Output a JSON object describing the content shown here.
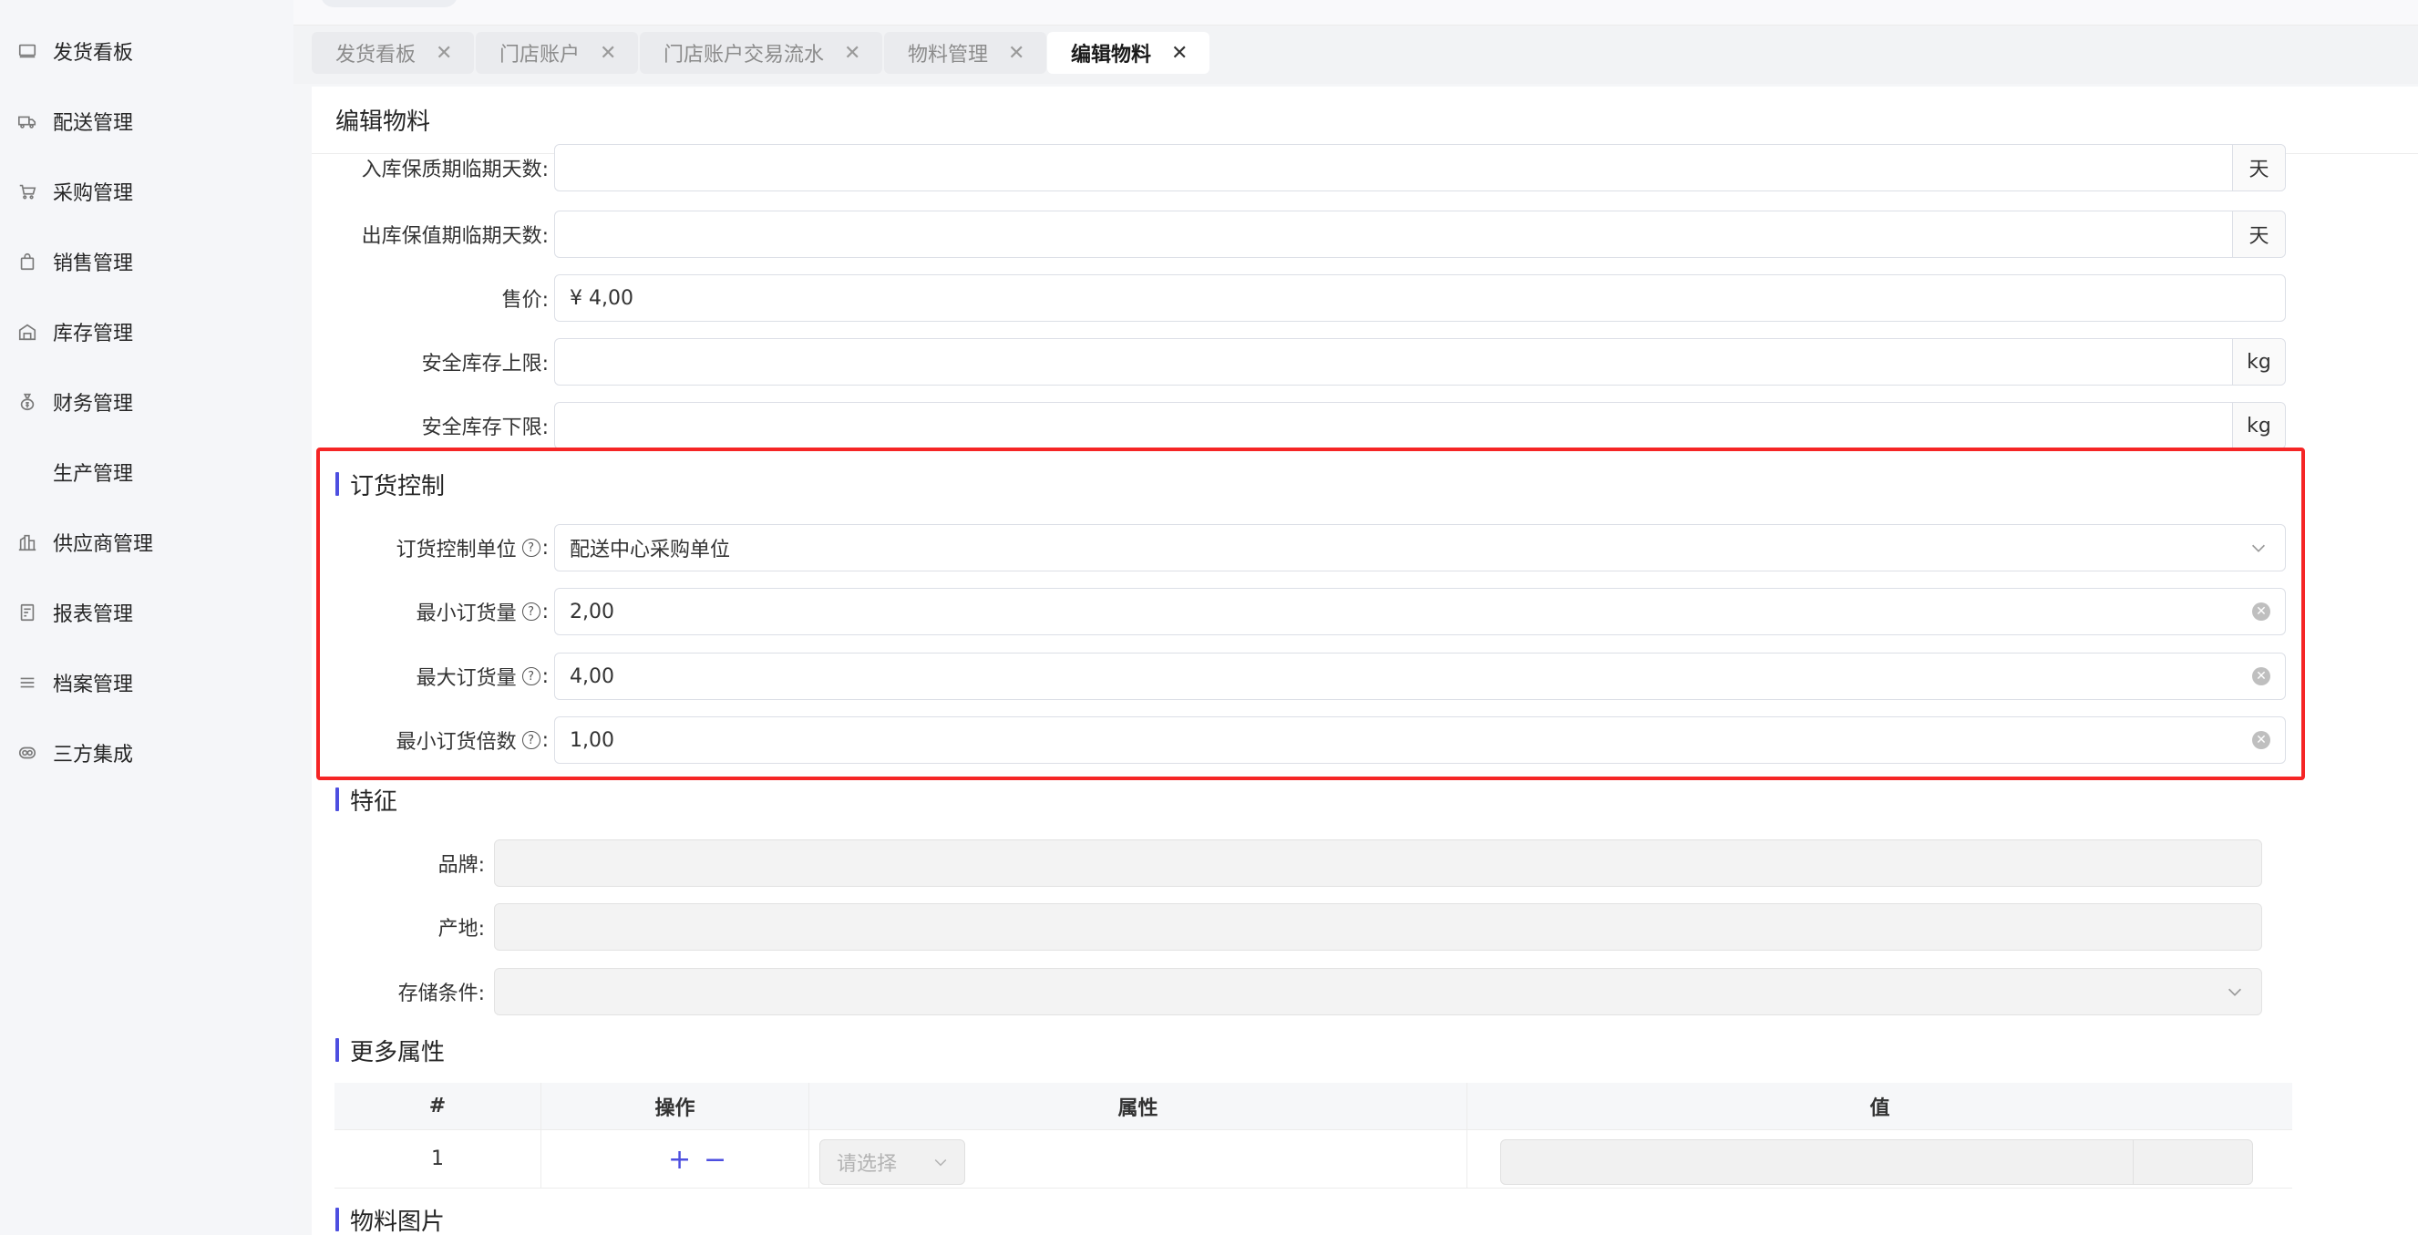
{
  "sidebar": {
    "items": [
      {
        "label": "发货看板",
        "icon": "monitor-icon"
      },
      {
        "label": "配送管理",
        "icon": "truck-icon"
      },
      {
        "label": "采购管理",
        "icon": "cart-icon"
      },
      {
        "label": "销售管理",
        "icon": "bag-icon"
      },
      {
        "label": "库存管理",
        "icon": "warehouse-icon"
      },
      {
        "label": "财务管理",
        "icon": "money-bag-icon"
      },
      {
        "label": "生产管理",
        "icon": ""
      },
      {
        "label": "供应商管理",
        "icon": "building-icon"
      },
      {
        "label": "报表管理",
        "icon": "report-icon"
      },
      {
        "label": "档案管理",
        "icon": "list-icon"
      },
      {
        "label": "三方集成",
        "icon": "integration-icon"
      }
    ]
  },
  "tabs": [
    {
      "label": "发货看板",
      "active": false
    },
    {
      "label": "门店账户",
      "active": false
    },
    {
      "label": "门店账户交易流水",
      "active": false
    },
    {
      "label": "物料管理",
      "active": false
    },
    {
      "label": "编辑物料",
      "active": true
    }
  ],
  "tab_close_glyph": "✕",
  "page": {
    "title": "编辑物料"
  },
  "form": {
    "inbound_expiry_days": {
      "label": "入库保质期临期天数:",
      "value": "",
      "suffix": "天"
    },
    "outbound_expiry_days": {
      "label": "出库保值期临期天数:",
      "value": "",
      "suffix": "天"
    },
    "price": {
      "label": "售价:",
      "value": "¥ 4,00"
    },
    "safety_upper": {
      "label": "安全库存上限:",
      "value": "",
      "suffix": "kg"
    },
    "safety_lower": {
      "label": "安全库存下限:",
      "value": "",
      "suffix": "kg"
    }
  },
  "order_control": {
    "title": "订货控制",
    "unit": {
      "label": "订货控制单位",
      "value": "配送中心采购单位"
    },
    "min_qty": {
      "label": "最小订货量",
      "value": "2,00"
    },
    "max_qty": {
      "label": "最大订货量",
      "value": "4,00"
    },
    "min_multiple": {
      "label": "最小订货倍数",
      "value": "1,00"
    },
    "help_glyph": "?",
    "colon": ":",
    "clear_glyph": "✕"
  },
  "features": {
    "title": "特征",
    "brand": {
      "label": "品牌:",
      "value": ""
    },
    "origin": {
      "label": "产地:",
      "value": ""
    },
    "storage": {
      "label": "存储条件:",
      "value": ""
    }
  },
  "more_attrs": {
    "title": "更多属性",
    "columns": [
      "#",
      "操作",
      "属性",
      "值"
    ],
    "rows": [
      {
        "index": "1",
        "add": "+",
        "remove": "−",
        "attribute_placeholder": "请选择",
        "value": ""
      }
    ]
  },
  "images": {
    "title": "物料图片"
  },
  "colors": {
    "accent": "#4d4fe0",
    "highlight": "#f52525"
  }
}
